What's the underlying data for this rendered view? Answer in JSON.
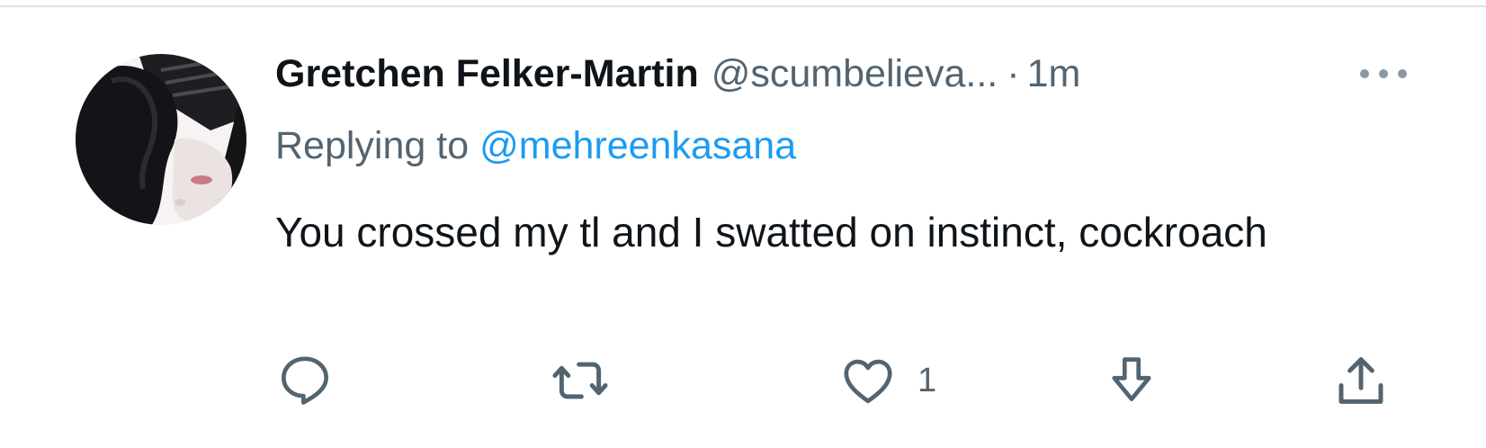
{
  "tweet": {
    "display_name": "Gretchen Felker-Martin",
    "handle": "@scumbelieva...",
    "separator": "·",
    "timestamp": "1m",
    "reply_prefix": "Replying to",
    "reply_handle": "@mehreenkasana",
    "text": "You crossed my tl and I swatted on instinct, cockroach"
  },
  "actions": {
    "reply_icon": "reply-icon",
    "retweet_icon": "retweet-icon",
    "like_icon": "heart-icon",
    "like_count": "1",
    "downvote_icon": "downvote-icon",
    "share_icon": "share-icon",
    "more_icon": "more-icon"
  },
  "colors": {
    "text_primary": "#0f1419",
    "text_secondary": "#536471",
    "link": "#1d9bf0",
    "divider": "#dde1e4"
  }
}
